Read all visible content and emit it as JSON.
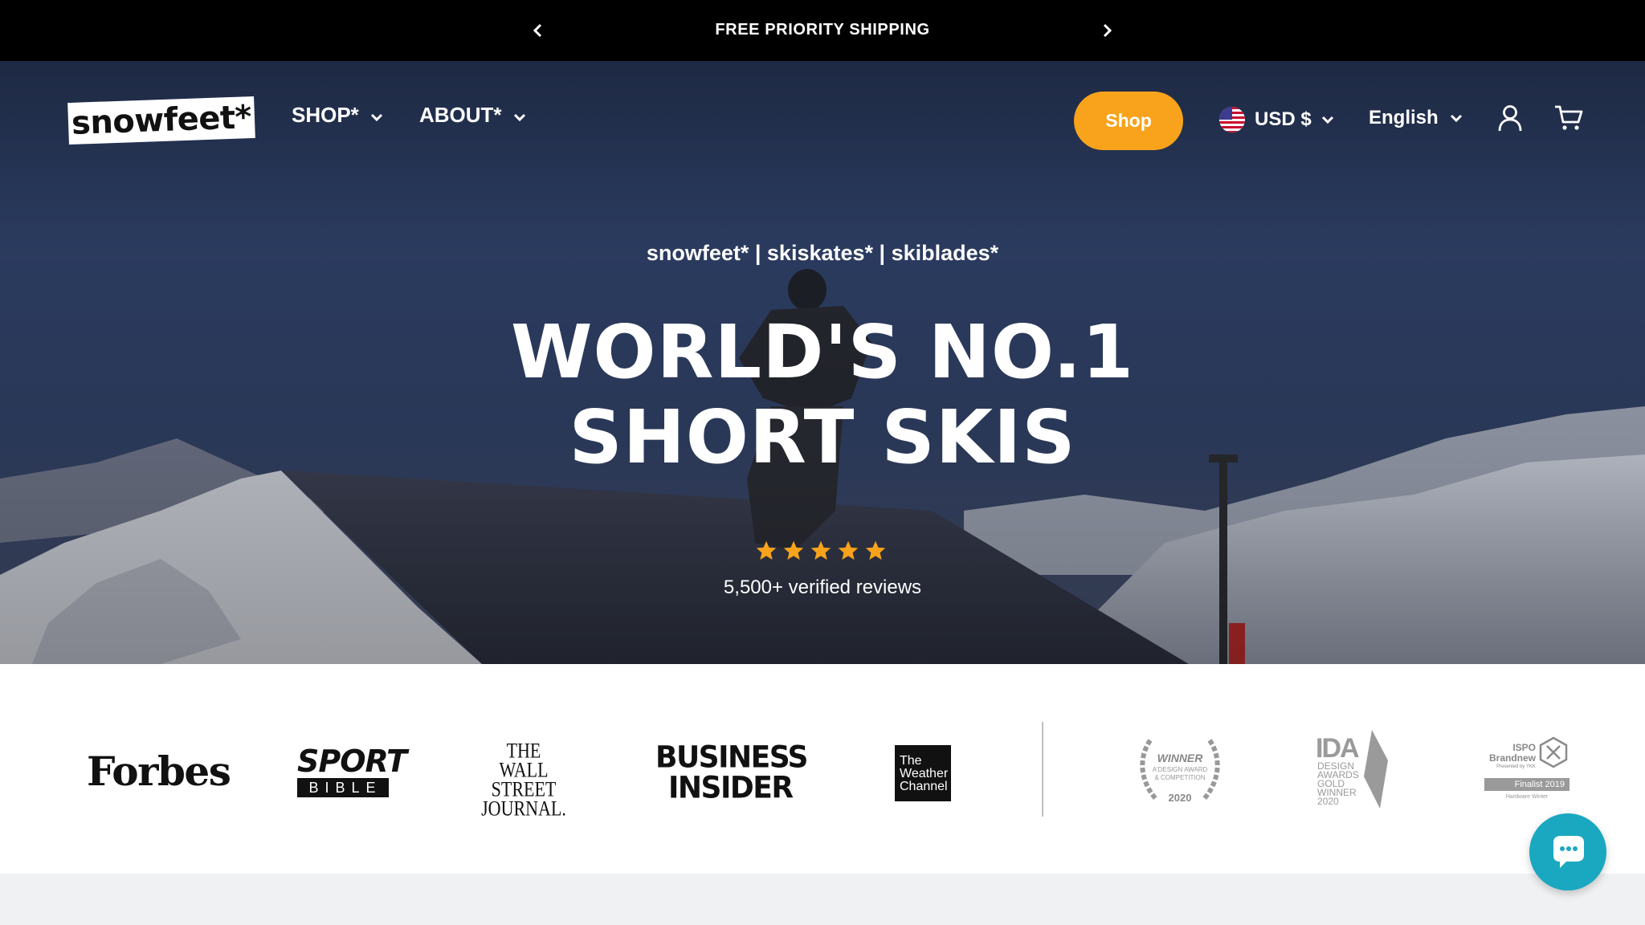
{
  "announcement": {
    "text": "FREE PRIORITY SHIPPING",
    "prev_icon": "chevron-left-icon",
    "next_icon": "chevron-right-icon"
  },
  "header": {
    "logo_text": "snowfeet*",
    "nav": [
      {
        "label": "SHOP*"
      },
      {
        "label": "ABOUT*"
      }
    ],
    "shop_button": "Shop",
    "currency": "USD $",
    "language": "English",
    "account_icon": "user-icon",
    "cart_icon": "cart-icon"
  },
  "hero": {
    "subtitle": "snowfeet* | skiskates* | skiblades*",
    "title_line1": "WORLD'S NO.1",
    "title_line2": "SHORT SKIS",
    "rating": 5,
    "reviews": "5,500+ verified reviews"
  },
  "press": {
    "forbes": "Forbes",
    "sport_bible_top": "SPORT",
    "sport_bible_bottom": "BIBLE",
    "wsj_line1": "THE",
    "wsj_line2": "WALL STREET",
    "wsj_line3": "JOURNAL.",
    "bi_line1": "BUSINESS",
    "bi_line2": "INSIDER",
    "weather_line1": "The",
    "weather_line2": "Weather",
    "weather_line3": "Channel",
    "award1_title": "WINNER",
    "award1_sub1": "A'DESIGN AWARD",
    "award1_sub2": "& COMPETITION",
    "award1_year": "2020",
    "award2_title": "IDA",
    "award2_l1": "DESIGN",
    "award2_l2": "AWARDS",
    "award2_l3": "GOLD",
    "award2_l4": "WINNER",
    "award2_l5": "2020",
    "award3_l1": "ISPO",
    "award3_l2": "Brandnew",
    "award3_l3": "Presented by YKK",
    "award3_l4": "Finalist 2019",
    "award3_l5": "Hardware Winter"
  },
  "colors": {
    "accent": "#f8a31b",
    "chat": "#1aa8c0",
    "star": "#f8a31b"
  },
  "chat_icon": "chat-bubble-icon"
}
